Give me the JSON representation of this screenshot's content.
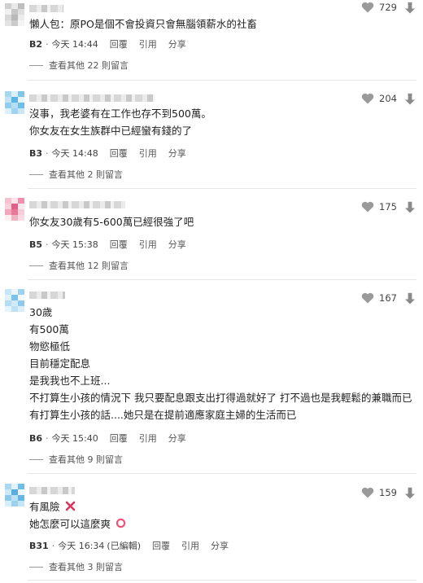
{
  "comments": [
    {
      "lines": [
        "懶人包：原PO是個不會投資只會無腦領薪水的社畜"
      ],
      "floor": "B2",
      "time": "今天 14:44",
      "edited": "",
      "reply": "回覆",
      "quote": "引用",
      "share": "分享",
      "likes": "729",
      "more": "查看其他 22 則留言"
    },
    {
      "lines": [
        "沒事，我老婆有在工作也存不到500萬。",
        "你女友在女生族群中已經蠻有錢的了"
      ],
      "floor": "B3",
      "time": "今天 14:48",
      "edited": "",
      "reply": "回覆",
      "quote": "引用",
      "share": "分享",
      "likes": "204",
      "more": "查看其他 2 則留言"
    },
    {
      "lines": [
        "你女友30歲有5-600萬已經很強了吧"
      ],
      "floor": "B5",
      "time": "今天 15:38",
      "edited": "",
      "reply": "回覆",
      "quote": "引用",
      "share": "分享",
      "likes": "175",
      "more": "查看其他 12 則留言"
    },
    {
      "lines": [
        "30歲",
        "有500萬",
        "物慾極低",
        "目前穩定配息",
        "是我我也不上班...",
        "不打算生小孩的情況下 我只要配息跟支出打得過就好了 打不過也是我輕鬆的兼職而已",
        "有打算生小孩的話....她只是在提前適應家庭主婦的生活而已"
      ],
      "floor": "B6",
      "time": "今天 15:40",
      "edited": "",
      "reply": "回覆",
      "quote": "引用",
      "share": "分享",
      "likes": "167",
      "more": "查看其他 9 則留言"
    },
    {
      "lines": [
        "有風險",
        "她怎麼可以這麼爽"
      ],
      "floor": "B31",
      "time": "今天 16:34",
      "edited": "(已編輯)",
      "reply": "回覆",
      "quote": "引用",
      "share": "分享",
      "likes": "159",
      "more": "查看其他 3 則留言"
    }
  ],
  "icons": {
    "like": "heart-icon",
    "dislike": "arrow-down-icon",
    "cross": "cross-mark-icon",
    "circle": "circle-mark-icon"
  },
  "colors": {
    "heart": "#9a9a9a",
    "arrow": "#8a8a8a",
    "cross": "#e0335d",
    "circle": "#f0527a"
  }
}
